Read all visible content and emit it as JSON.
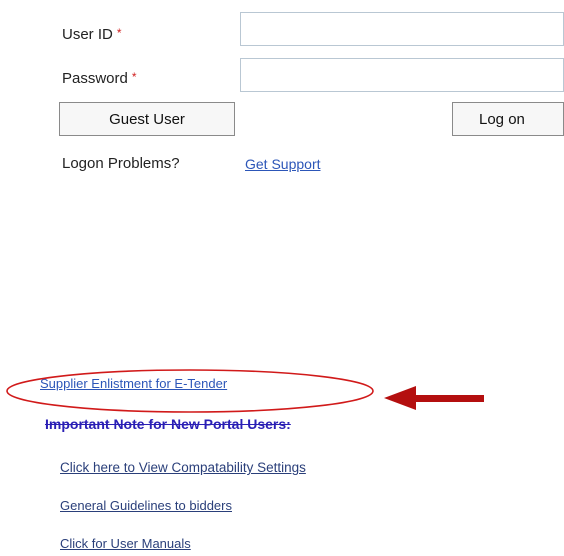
{
  "login": {
    "user_id_label": "User ID",
    "password_label": "Password",
    "required_mark": "*",
    "user_id_value": "",
    "password_value": "",
    "guest_button": "Guest User",
    "logon_button": "Log on",
    "problems_text": "Logon Problems?",
    "support_link": "Get Support"
  },
  "links": {
    "supplier_enlistment": "Supplier Enlistment for E-Tender",
    "important_note": "Important Note for New Portal Users:",
    "compatibility": "Click here to View Compatability Settings",
    "guidelines": "General Guidelines to bidders",
    "manuals": "Click for User Manuals"
  },
  "annotation": {
    "ellipse_color": "#d11a1a",
    "arrow_color": "#b40f0f"
  }
}
